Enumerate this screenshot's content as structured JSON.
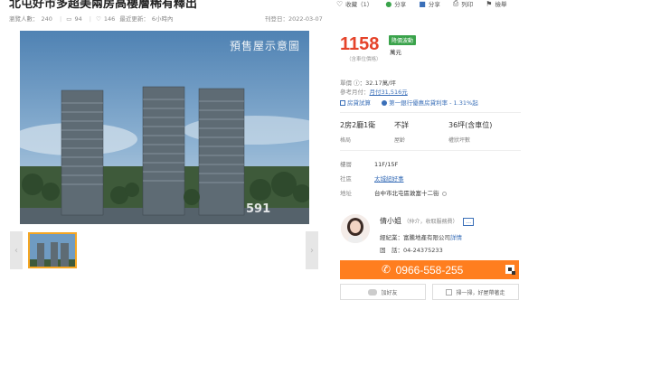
{
  "listing": {
    "title": "北屯好市多超美兩房高樓層稀有釋出",
    "views_label": "瀏覽人數：",
    "views": "240",
    "comments": "94",
    "favorites": "146",
    "updated_label": "最近更新：",
    "updated": "6小時內",
    "posted": "刊登日：2022-03-07"
  },
  "actions": [
    {
      "label": "收藏（1）",
      "icon": "heart-icon"
    },
    {
      "label": "分享",
      "icon": "line-share-icon"
    },
    {
      "label": "分享",
      "icon": "facebook-share-icon"
    },
    {
      "label": "列印",
      "icon": "print-icon"
    },
    {
      "label": "檢舉",
      "icon": "report-icon"
    }
  ],
  "photo": {
    "label": "預售屋示意圖",
    "watermark": "591",
    "watermark_sub": "房屋交易 591.com.tw"
  },
  "nav": {
    "prev": "‹",
    "next": "›"
  },
  "price": {
    "value": "1158",
    "unit": "萬元",
    "note": "（含車位價格）",
    "badge": "降價波動"
  },
  "unit_price": {
    "label": "單價",
    "value": "：32.17萬/坪"
  },
  "monthly": {
    "label": "參考月付：",
    "value": "月付31,516元"
  },
  "loan": {
    "calc": "房貸試算",
    "rate": "第一銀行優惠房貸利率 - 1.31%起"
  },
  "specs": [
    {
      "value": "2房2廳1衛",
      "label": "格局"
    },
    {
      "value": "不詳",
      "label": "屋齡"
    },
    {
      "value": "36坪(含車位)",
      "label": "權狀坪數"
    }
  ],
  "details": {
    "floor_label": "樓層",
    "floor": "11F/15F",
    "community_label": "社區",
    "community": "太城紐好事",
    "address_label": "地址",
    "address": "台中市北屯區敦富十二街"
  },
  "agent": {
    "name": "倩小姐",
    "role": "（仲介，收取服務費）",
    "company": "經紀業：富騰地產有限公司",
    "detail_link": "詳情",
    "tel_label": "固　話：",
    "tel": "04-24375233"
  },
  "phone": "0966-558-255",
  "buttons": {
    "line": "加好友",
    "buy": "掃一掃，好屋帶著走"
  },
  "colors": {
    "price": "#e5432a",
    "badge": "#3aa34b",
    "phone_button": "#ff7e1f",
    "link": "#3a6fb8"
  }
}
